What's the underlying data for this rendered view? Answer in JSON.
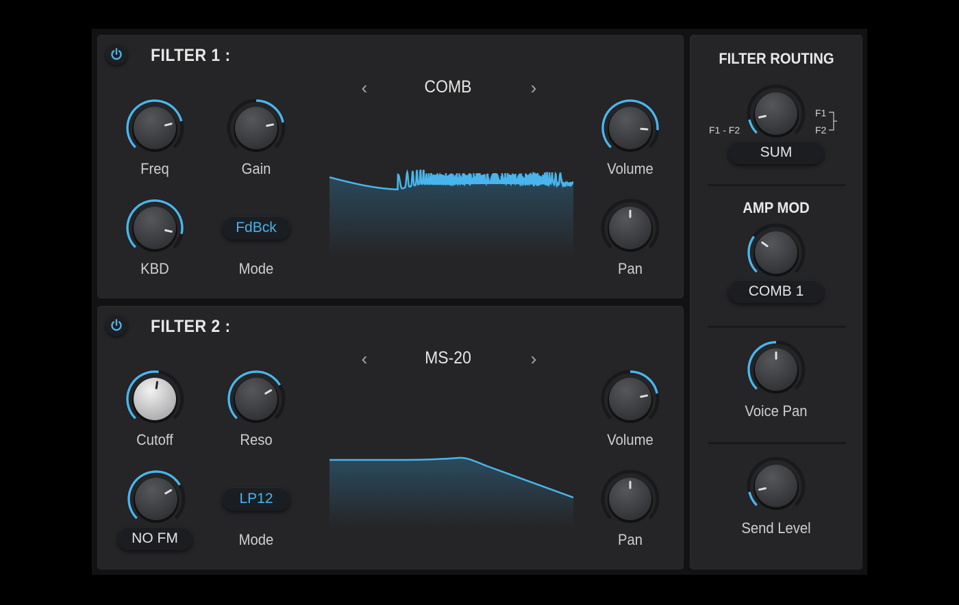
{
  "colors": {
    "accent": "#4ab5ec",
    "panel": "#252527",
    "text": "#e6e6e6",
    "background": "#000000"
  },
  "filter1": {
    "title": "FILTER 1 :",
    "enabled": true,
    "type": "COMB",
    "prev_icon": "chevron-left-icon",
    "next_icon": "chevron-right-icon",
    "knobs": {
      "freq": {
        "label": "Freq",
        "value": 0.78,
        "bipolar": false
      },
      "gain": {
        "label": "Gain",
        "value": 0.79,
        "bipolar": true
      },
      "kbd": {
        "label": "KBD",
        "value": 0.88,
        "bipolar": false,
        "full_arc": true
      },
      "volume": {
        "label": "Volume",
        "value": 0.85,
        "bipolar": false
      },
      "pan": {
        "label": "Pan",
        "value": 0.5,
        "bipolar": true
      }
    },
    "mode": {
      "label": "Mode",
      "value": "FdBck"
    },
    "response": "comb"
  },
  "filter2": {
    "title": "FILTER 2 :",
    "enabled": true,
    "type": "MS-20",
    "prev_icon": "chevron-left-icon",
    "next_icon": "chevron-right-icon",
    "knobs": {
      "cutoff": {
        "label": "Cutoff",
        "value": 0.53,
        "bipolar": false,
        "light": true
      },
      "reso": {
        "label": "Reso",
        "value": 0.72,
        "bipolar": false
      },
      "fm": {
        "value": 0.72,
        "bipolar": false
      },
      "volume": {
        "label": "Volume",
        "value": 0.79,
        "bipolar": true
      },
      "pan": {
        "label": "Pan",
        "value": 0.5,
        "bipolar": true
      }
    },
    "fm_source": "NO FM",
    "mode": {
      "label": "Mode",
      "value": "LP12"
    },
    "response": "lowpass"
  },
  "sidebar": {
    "filter_routing": {
      "title": "FILTER ROUTING",
      "value": 0.12,
      "left_label": "F1 - F2",
      "right_top": "F1",
      "right_bottom": "F2",
      "mode": "SUM"
    },
    "amp_mod": {
      "title": "AMP MOD",
      "value": 0.3,
      "source": "COMB 1"
    },
    "voice_pan": {
      "label": "Voice Pan",
      "value": 0.5
    },
    "send_level": {
      "label": "Send Level",
      "value": 0.12
    }
  }
}
